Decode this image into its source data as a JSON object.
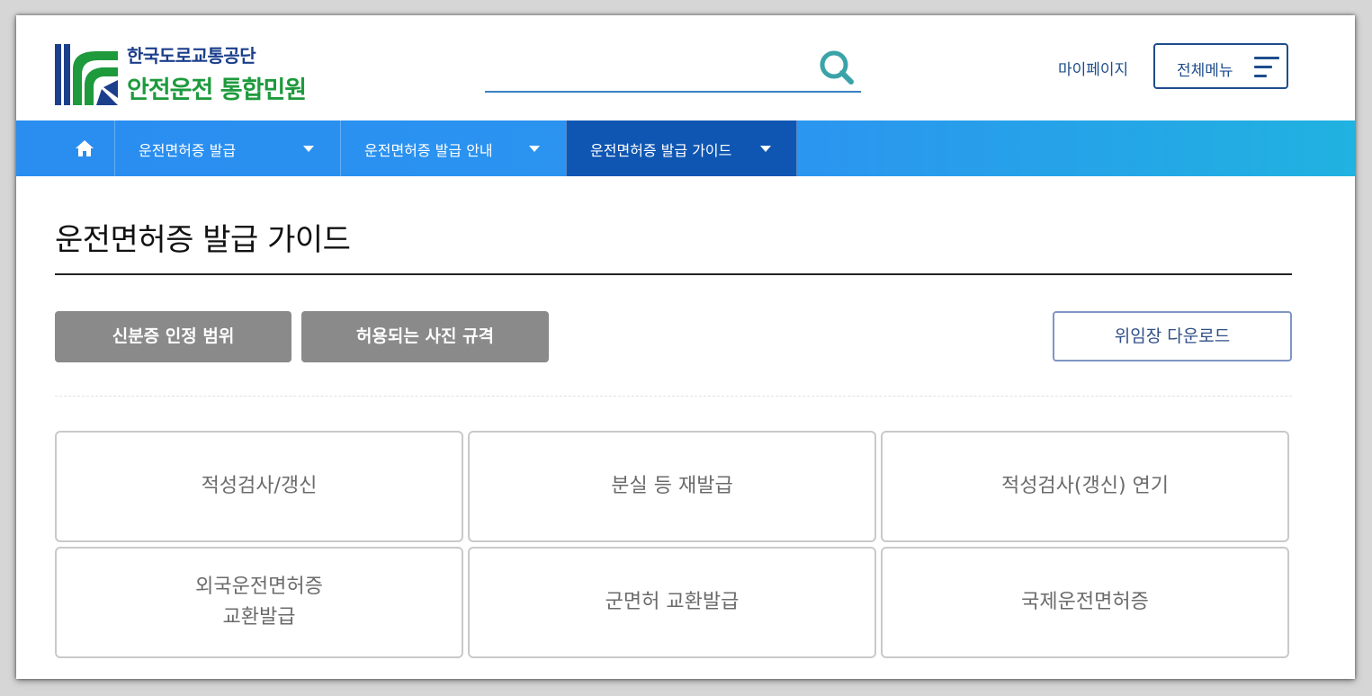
{
  "header": {
    "org_name": "한국도로교통공단",
    "service_name": "안전운전 통합민원",
    "search_placeholder": "",
    "mypage_label": "마이페이지",
    "allmenu_label": "전체메뉴"
  },
  "nav": {
    "home_icon": "home-icon",
    "items": [
      {
        "label": "운전면허증 발급"
      },
      {
        "label": "운전면허증 발급 안내"
      },
      {
        "label": "운전면허증 발급 가이드"
      }
    ],
    "active_index": 2
  },
  "main": {
    "title": "운전면허증 발급 가이드",
    "buttons": {
      "id_scope": "신분증 인정 범위",
      "photo_spec": "허용되는 사진 규격",
      "proxy_download": "위임장 다운로드"
    },
    "cards": [
      {
        "label": "적성검사/갱신"
      },
      {
        "label": "분실 등 재발급"
      },
      {
        "label": "적성검사(갱신) 연기"
      },
      {
        "label": "외국운전면허증\n교환발급"
      },
      {
        "label": "군면허 교환발급"
      },
      {
        "label": "국제운전면허증"
      }
    ]
  },
  "colors": {
    "brand_navy": "#1e4d8c",
    "brand_green": "#1e9a3d",
    "nav_blue": "#2a8df0",
    "nav_active": "#0f56b3",
    "gray_button": "#8a8a8a"
  }
}
